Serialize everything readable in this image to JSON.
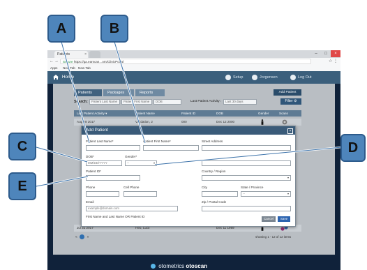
{
  "browser": {
    "tabs": [
      {
        "label": "Patients"
      },
      {
        "label": ""
      }
    ],
    "url_secure_label": "Secure",
    "url": "https://qa.earscan...om/ClinicPortal",
    "bookmarks": [
      "Apps",
      "New Tab",
      "New Tab"
    ]
  },
  "app": {
    "home_label": "Home",
    "setup_label": "Setup",
    "user_label": "Jorgensen",
    "logout_label": "Log Out"
  },
  "page": {
    "tabs": [
      "Patients",
      "Packages",
      "Reports"
    ],
    "add_patient_label": "Add Patient",
    "search_label": "Search:",
    "search_fields": [
      "Patient Last Name",
      "Patient First Name",
      "DOB"
    ],
    "last_activity_label": "Last Patient Activity:",
    "last_activity_value": "Last 30 days",
    "filter_label": "Filter",
    "table_headers": [
      "Last Patient Activity ▾",
      "Patient Name",
      "Patient ID",
      "DOB",
      "Gender",
      "Scans"
    ],
    "rows": [
      {
        "activity": "Aug 28 2017",
        "name": "Validation, 2",
        "id": "000",
        "dob": "Dec 12 2000"
      },
      {
        "activity": "Jul 31 2017",
        "name": "Heo, Lucil",
        "id": "",
        "dob": "Dec 11 1969"
      }
    ],
    "pager_prev": "«",
    "pager_page": "1",
    "pager_next": "»",
    "showing": "showing 1 - 12 of 12 items"
  },
  "modal": {
    "title": "Add Patient",
    "close_icon": "close-icon",
    "fields": {
      "last_name_label": "Patient Last Name*",
      "first_name_label": "Patient First Name*",
      "street_label": "Street Address",
      "dob_label": "DOB*",
      "dob_placeholder": "MM/DD/YYYY",
      "gender_label": "Gender*",
      "gender_value": "--",
      "patient_id_label": "Patient ID*",
      "country_label": "Country / Region",
      "phone_label": "Phone",
      "cell_label": "Cell Phone",
      "city_label": "City",
      "state_label": "State / Province",
      "state_value": "--",
      "email_label": "Email",
      "email_placeholder": "example@domain.com",
      "zip_label": "Zip / Postal Code",
      "hint": "First Name and Last Name OR Patient ID"
    },
    "cancel_label": "Cancel",
    "save_label": "Save"
  },
  "brand": {
    "name_light": "otometrics",
    "name_bold": "otoscan"
  },
  "callouts": [
    "A",
    "B",
    "C",
    "D",
    "E"
  ],
  "colors": {
    "callout_fill": "#4e85bb",
    "app_header": "#3b5f7c",
    "save_button": "#2b63b0",
    "monitor_frame": "#10223a"
  }
}
